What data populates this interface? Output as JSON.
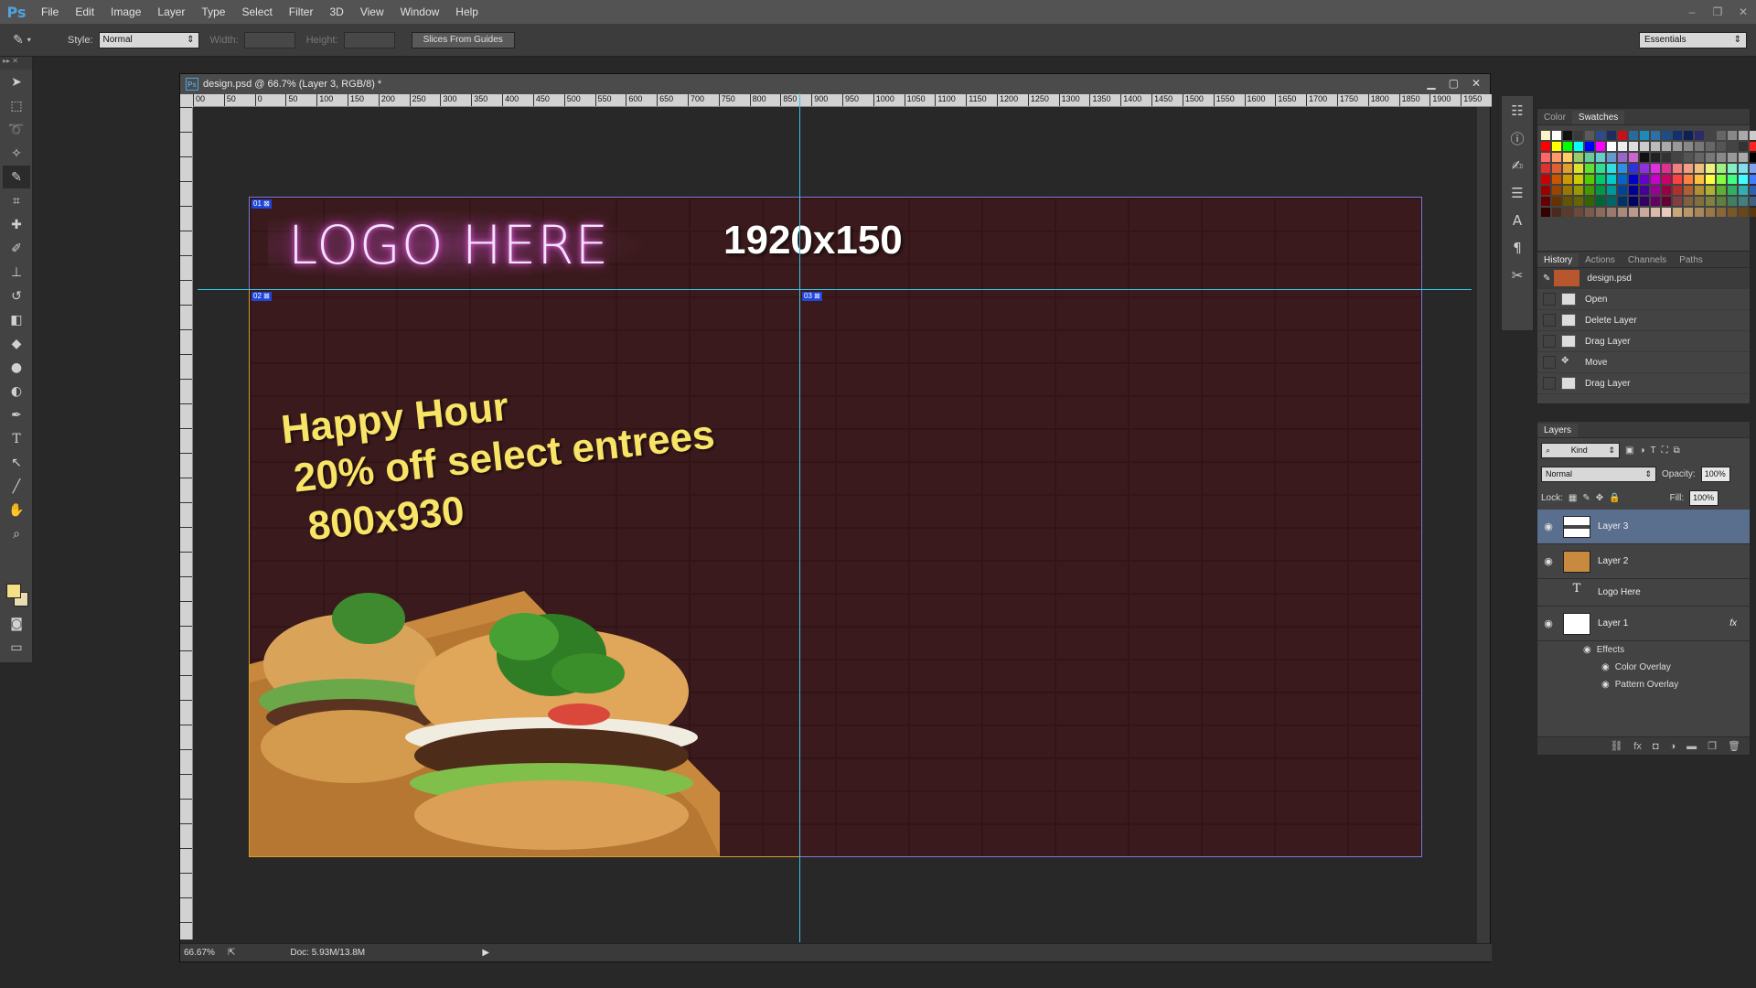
{
  "app": {
    "logo": "Ps",
    "menu": [
      "File",
      "Edit",
      "Image",
      "Layer",
      "Type",
      "Select",
      "Filter",
      "3D",
      "View",
      "Window",
      "Help"
    ],
    "window_controls": [
      "–",
      "❐",
      "✕"
    ]
  },
  "options_bar": {
    "style_label": "Style:",
    "style_value": "Normal",
    "width_label": "Width:",
    "height_label": "Height:",
    "slices_button": "Slices From Guides",
    "workspace": "Essentials"
  },
  "tools": [
    "move-tool",
    "marquee-tool",
    "lasso-tool",
    "magic-wand-tool",
    "slice-tool",
    "eyedropper-tool",
    "healing-brush-tool",
    "brush-tool",
    "clone-stamp-tool",
    "history-brush-tool",
    "eraser-tool",
    "paint-bucket-tool",
    "blur-tool",
    "dodge-tool",
    "pen-tool",
    "type-tool",
    "path-selection-tool",
    "line-tool",
    "hand-tool",
    "zoom-tool"
  ],
  "colors": {
    "foreground": "#f6de86",
    "background": "#e8dcb0",
    "accent_guide": "#34c6e8",
    "slice_line": "#d89c2c",
    "slice_tag": "#2046d8"
  },
  "document": {
    "title": "design.psd @ 66.7% (Layer 3, RGB/8) *",
    "ps_icon": "Ps",
    "ruler_labels": [
      "00",
      "50",
      "0",
      "50",
      "100",
      "150",
      "200",
      "250",
      "300",
      "350",
      "400",
      "450",
      "500",
      "550",
      "600",
      "650",
      "700",
      "750",
      "800",
      "850",
      "900",
      "950",
      "1000",
      "1050",
      "1100",
      "1150",
      "1200",
      "1250",
      "1300",
      "1350",
      "1400",
      "1450",
      "1500",
      "1550",
      "1600",
      "1650",
      "1700",
      "1750",
      "1800",
      "1850",
      "1900",
      "1950"
    ],
    "zoom": "66.67%",
    "doc_size": "Doc: 5.93M/13.8M"
  },
  "canvas": {
    "logo": "LOGO HERE",
    "banner_size": "1920x150",
    "promo_line1": "Happy Hour",
    "promo_line2": "20% off select entrees",
    "promo_line3": "800x930",
    "slice_tags": [
      "01",
      "02",
      "03"
    ]
  },
  "color_panel": {
    "tabs": [
      "Color",
      "Swatches"
    ],
    "active_tab": "Swatches",
    "swatches": [
      "#fff3c8",
      "#ffffff",
      "#111111",
      "#3a3a3a",
      "#5a5a5a",
      "#2b4b8b",
      "#1c2d5e",
      "#c8101a",
      "#2a6a9a",
      "#1c8bbc",
      "#2f6fa8",
      "#1a4d8a",
      "#103070",
      "#0e2056",
      "#2b2b6b",
      "#444444",
      "#666666",
      "#888888",
      "#aaaaaa",
      "#cccccc",
      "#1a1a1a",
      "#ff0000",
      "#ffff00",
      "#00ff00",
      "#00ffff",
      "#0000ff",
      "#ff00ff",
      "#ffffff",
      "#eeeeee",
      "#dddddd",
      "#cccccc",
      "#bbbbbb",
      "#aaaaaa",
      "#999999",
      "#888888",
      "#777777",
      "#666666",
      "#555555",
      "#444444",
      "#333333",
      "#ff2020",
      "#ffcc00",
      "#ff6666",
      "#ff9966",
      "#ffcc66",
      "#99cc66",
      "#66cc99",
      "#66cccc",
      "#6699cc",
      "#9966cc",
      "#cc66cc",
      "#111111",
      "#222222",
      "#333333",
      "#444444",
      "#555555",
      "#666666",
      "#777777",
      "#888888",
      "#999999",
      "#aaaaaa",
      "#000000",
      "#ff99cc",
      "#e03030",
      "#e06030",
      "#e0a030",
      "#e0e030",
      "#60e030",
      "#30e090",
      "#30e0e0",
      "#3090e0",
      "#3030e0",
      "#9030e0",
      "#e030e0",
      "#e03090",
      "#f08080",
      "#f0a080",
      "#f0c080",
      "#f0f080",
      "#a0f080",
      "#80f0c0",
      "#80e0f0",
      "#80a0f0",
      "#c080f0",
      "#cc0000",
      "#cc5500",
      "#cc9900",
      "#cccc00",
      "#55cc00",
      "#00cc66",
      "#00cccc",
      "#0066cc",
      "#0000cc",
      "#6600cc",
      "#cc00cc",
      "#cc0066",
      "#ff4040",
      "#ff8040",
      "#ffc040",
      "#ffff40",
      "#80ff40",
      "#40ff80",
      "#40ffff",
      "#4080ff",
      "#8040ff",
      "#990000",
      "#994400",
      "#997700",
      "#999900",
      "#449900",
      "#009944",
      "#009999",
      "#004499",
      "#000099",
      "#440099",
      "#990099",
      "#990044",
      "#b03030",
      "#b06030",
      "#b09030",
      "#b0b030",
      "#60b030",
      "#30b060",
      "#30b0b0",
      "#3060b0",
      "#6030b0",
      "#660000",
      "#663300",
      "#665500",
      "#666600",
      "#336600",
      "#006633",
      "#006666",
      "#003366",
      "#000066",
      "#330066",
      "#660066",
      "#660033",
      "#804040",
      "#806040",
      "#807040",
      "#808040",
      "#608040",
      "#408060",
      "#408080",
      "#406080",
      "#604080",
      "#330000",
      "#4a2a1a",
      "#5a3a2a",
      "#6a4a3a",
      "#7a5a4a",
      "#8a6a5a",
      "#9a7a6a",
      "#aa8a7a",
      "#ba9a8a",
      "#caaa9a",
      "#dabaaa",
      "#eacaba",
      "#c8a878",
      "#b89868",
      "#a88858",
      "#987848",
      "#886838",
      "#785828",
      "#684818",
      "#583808",
      "#482800"
    ]
  },
  "history_panel": {
    "tabs": [
      "History",
      "Actions",
      "Channels",
      "Paths"
    ],
    "snapshot": "design.psd",
    "items": [
      "Open",
      "Delete Layer",
      "Drag Layer",
      "Move",
      "Drag Layer"
    ]
  },
  "layers_panel": {
    "title": "Layers",
    "filter": "Kind",
    "blend_mode": "Normal",
    "opacity_label": "Opacity:",
    "opacity": "100%",
    "lock_label": "Lock:",
    "fill_label": "Fill:",
    "fill": "100%",
    "layers": [
      {
        "name": "Layer 3",
        "selected": true,
        "visible": true
      },
      {
        "name": "Layer 2",
        "selected": false,
        "visible": true
      },
      {
        "name": "Logo Here",
        "selected": false,
        "visible": false,
        "type": "text"
      },
      {
        "name": "Layer 1",
        "selected": false,
        "visible": true,
        "fx": "fx"
      }
    ],
    "effects_label": "Effects",
    "effects": [
      "Color Overlay",
      "Pattern Overlay"
    ]
  }
}
